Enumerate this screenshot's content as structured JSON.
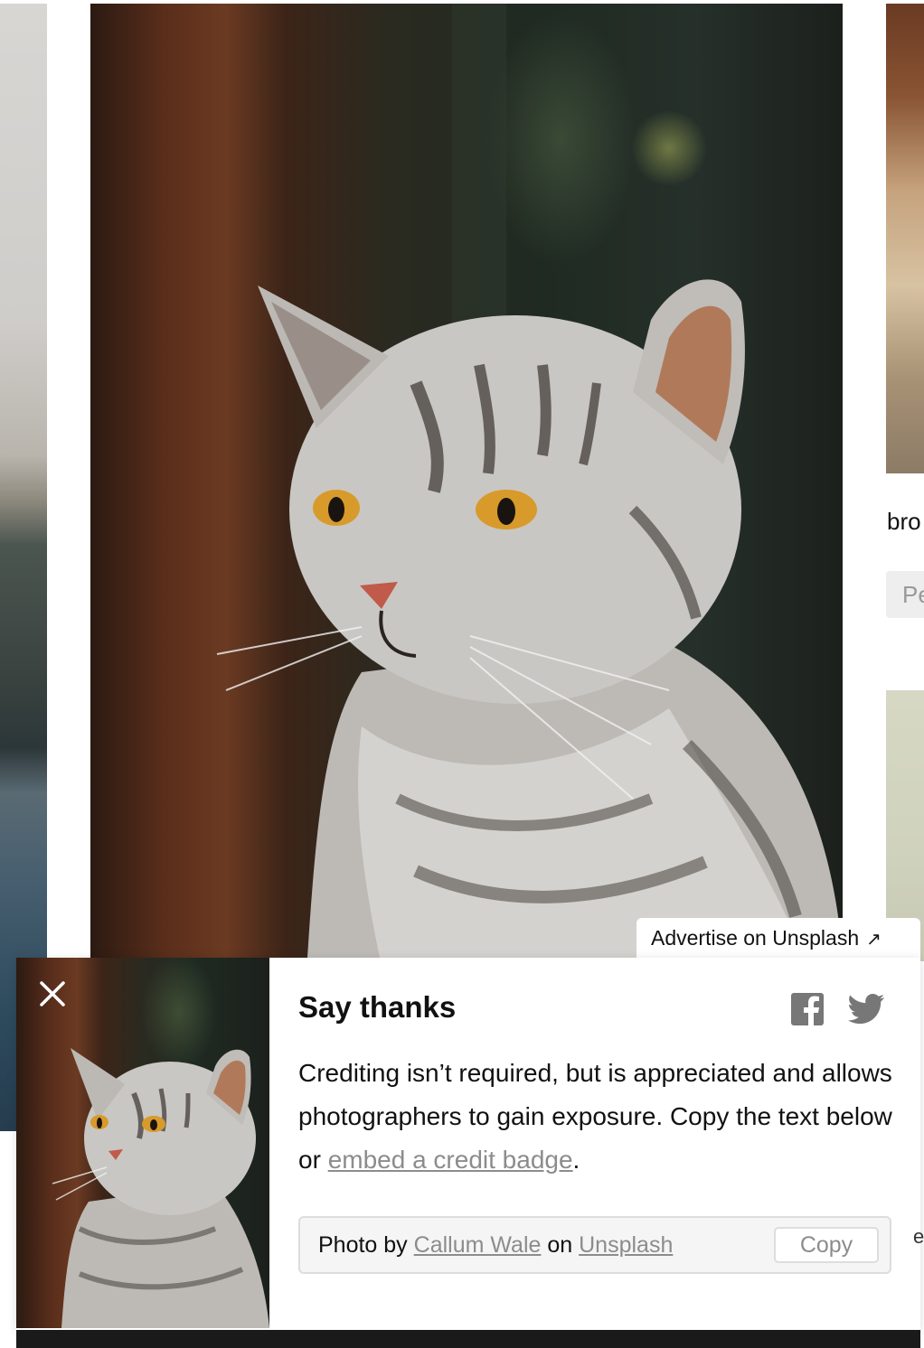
{
  "right_column": {
    "caption": "bro",
    "tag": "Pe",
    "edge_char": "e"
  },
  "advertise": {
    "label": "Advertise on Unsplash",
    "arrow": "↗"
  },
  "say_thanks": {
    "title": "Say thanks",
    "text_before_link": "Crediting isn’t required, but is appreciated and allows photographers to gain exposure. Copy the text below or ",
    "link_text": "embed a credit badge",
    "text_after_link": ".",
    "credit": {
      "prefix": "Photo by ",
      "photographer": "Callum Wale",
      "middle": " on ",
      "site": "Unsplash"
    },
    "copy_label": "Copy"
  },
  "icons": {
    "close": "close-icon",
    "facebook": "facebook-icon",
    "twitter": "twitter-icon",
    "external": "external-link-icon"
  },
  "colors": {
    "link_gray": "#8c8c8c",
    "panel_bg": "#ffffff",
    "credit_bg": "#f5f5f5",
    "icon_gray": "#777777"
  }
}
